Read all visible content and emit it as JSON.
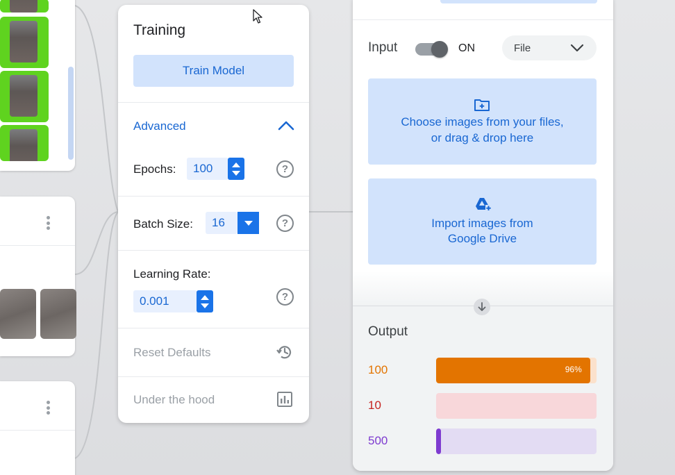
{
  "training": {
    "title": "Training",
    "train_button": "Train Model",
    "advanced_label": "Advanced",
    "epochs_label": "Epochs:",
    "epochs_value": "100",
    "batch_size_label": "Batch Size:",
    "batch_size_value": "16",
    "learning_rate_label": "Learning Rate:",
    "learning_rate_value": "0.001",
    "help_glyph": "?",
    "reset_defaults": "Reset Defaults",
    "under_the_hood": "Under the hood"
  },
  "preview": {
    "input_label": "Input",
    "toggle_state": "ON",
    "source_select": "File",
    "upload_line1": "Choose images from your files,",
    "upload_line2": "or drag & drop here",
    "drive_line1": "Import images from",
    "drive_line2": "Google Drive",
    "output_title": "Output",
    "output": [
      {
        "label": "100",
        "percent": 96,
        "percent_text": "96%",
        "color": "#e37400",
        "track": "#fbe1cc"
      },
      {
        "label": "10",
        "percent": 0,
        "percent_text": "",
        "color": "#c5221f",
        "track": "#f8d7da"
      },
      {
        "label": "500",
        "percent": 3,
        "percent_text": "",
        "color": "#7e3bd0",
        "track": "#e3dcf3"
      }
    ]
  },
  "colors": {
    "accent": "#1a73e8",
    "accent_light": "#d2e3fc",
    "class_thumb_green": "#5fd31f"
  }
}
